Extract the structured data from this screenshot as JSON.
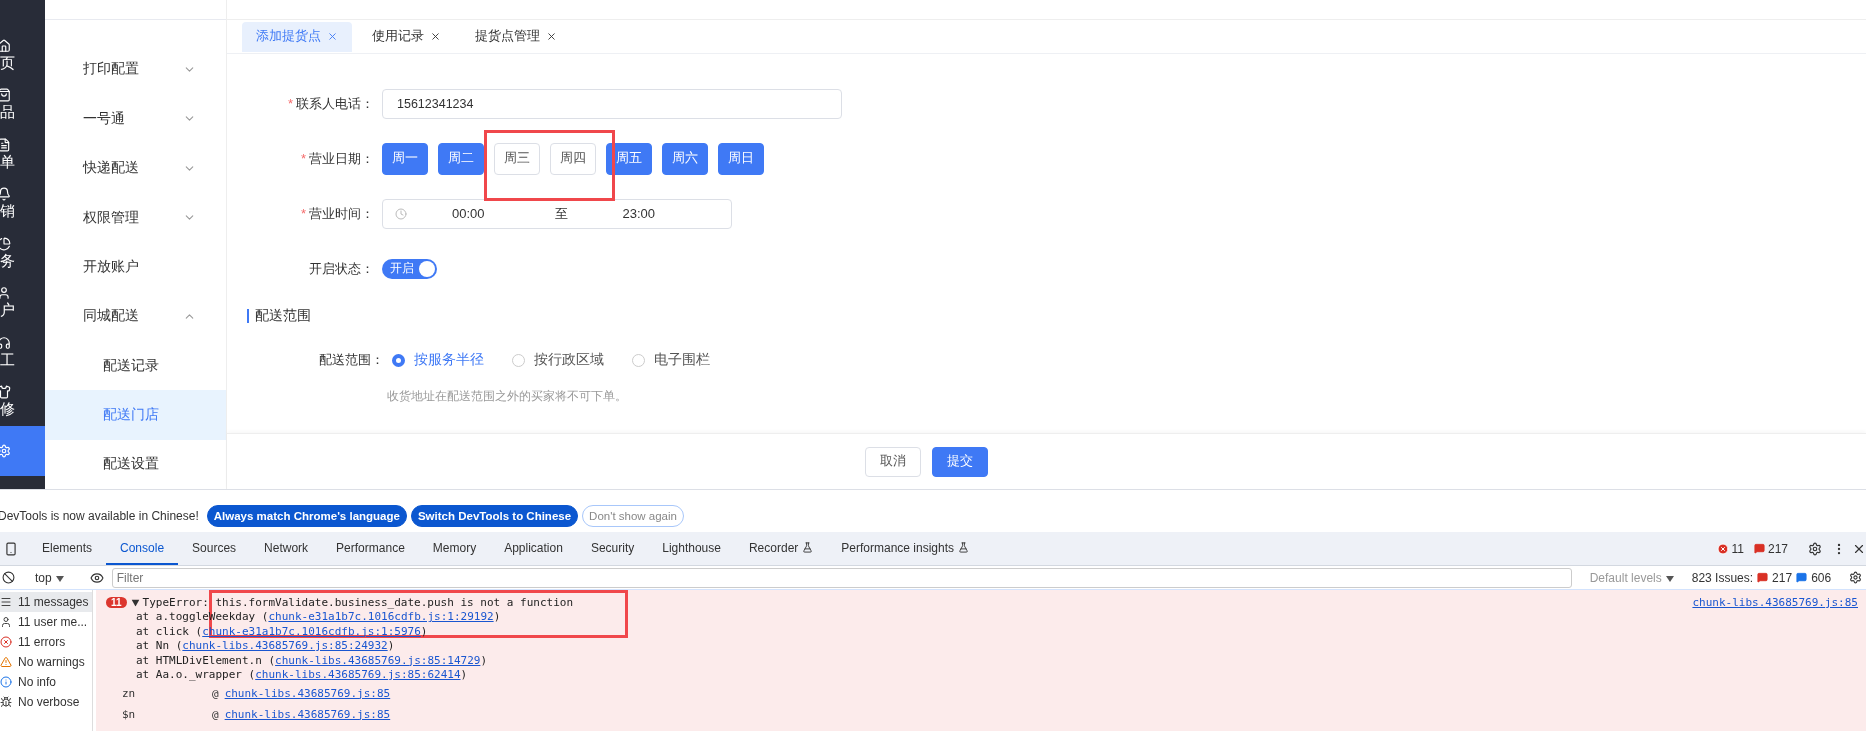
{
  "rail": [
    {
      "label": "页",
      "selected": false
    },
    {
      "label": "品",
      "selected": false
    },
    {
      "label": "单",
      "selected": false
    },
    {
      "label": "销",
      "selected": false
    },
    {
      "label": "务",
      "selected": false
    },
    {
      "label": "户",
      "selected": false
    },
    {
      "label": "工",
      "selected": false
    },
    {
      "label": "修",
      "selected": false
    },
    {
      "selected": true
    }
  ],
  "menu": [
    {
      "label": "打印配置",
      "kind": "group",
      "expanded": false
    },
    {
      "label": "一号通",
      "kind": "group",
      "expanded": false
    },
    {
      "label": "快递配送",
      "kind": "group",
      "expanded": false
    },
    {
      "label": "权限管理",
      "kind": "group",
      "expanded": false
    },
    {
      "label": "开放账户",
      "kind": "link"
    },
    {
      "label": "同城配送",
      "kind": "group",
      "expanded": true,
      "children": [
        {
          "label": "配送记录",
          "selected": false
        },
        {
          "label": "配送门店",
          "selected": true
        },
        {
          "label": "配送设置",
          "selected": false
        }
      ]
    }
  ],
  "tabs": [
    {
      "label": "添加提货点",
      "selected": true
    },
    {
      "label": "使用记录",
      "selected": false
    },
    {
      "label": "提货点管理",
      "selected": false
    }
  ],
  "form": {
    "required_mark": "*",
    "phone": {
      "label": "联系人电话：",
      "required": true,
      "value": "15612341234"
    },
    "days": {
      "label": "营业日期：",
      "required": true,
      "options": [
        {
          "label": "周一",
          "selected": true
        },
        {
          "label": "周二",
          "selected": true
        },
        {
          "label": "周三",
          "selected": false
        },
        {
          "label": "周四",
          "selected": false
        },
        {
          "label": "周五",
          "selected": true
        },
        {
          "label": "周六",
          "selected": true
        },
        {
          "label": "周日",
          "selected": true
        }
      ]
    },
    "hours": {
      "label": "营业时间：",
      "required": true,
      "start": "00:00",
      "separator": "至",
      "end": "23:00"
    },
    "status": {
      "label": "开启状态：",
      "on": true,
      "text": "开启"
    },
    "section": "配送范围",
    "scope": {
      "label": "配送范围：",
      "options": [
        {
          "label": "按服务半径",
          "selected": true
        },
        {
          "label": "按行政区域",
          "selected": false
        },
        {
          "label": "电子围栏",
          "selected": false
        }
      ],
      "hint": "收货地址在配送范围之外的买家将不可下单。"
    }
  },
  "footer": [
    {
      "label": "取消",
      "kind": "secondary"
    },
    {
      "label": "提交",
      "kind": "primary"
    }
  ],
  "devtools": {
    "banner": {
      "text": "DevTools is now available in Chinese!",
      "buttons": [
        {
          "label": "Always match Chrome's language",
          "kind": "filled"
        },
        {
          "label": "Switch DevTools to Chinese",
          "kind": "filled"
        },
        {
          "label": "Don't show again",
          "kind": "outline"
        }
      ]
    },
    "tabs": [
      {
        "label": "Elements",
        "selected": false
      },
      {
        "label": "Console",
        "selected": true
      },
      {
        "label": "Sources",
        "selected": false
      },
      {
        "label": "Network",
        "selected": false
      },
      {
        "label": "Performance",
        "selected": false
      },
      {
        "label": "Memory",
        "selected": false
      },
      {
        "label": "Application",
        "selected": false
      },
      {
        "label": "Security",
        "selected": false
      },
      {
        "label": "Lighthouse",
        "selected": false
      },
      {
        "label": "Recorder",
        "selected": false,
        "experimental": true
      },
      {
        "label": "Performance insights",
        "selected": false,
        "experimental": true
      }
    ],
    "error_count": "11",
    "issue_count": "217",
    "toolbar": {
      "context": "top",
      "filter_placeholder": "Filter",
      "levels": "Default levels",
      "issues_label": "823 Issues:",
      "issues_errors": "217",
      "issues_info": "606"
    },
    "sidebar": [
      {
        "label": "11 messages",
        "selected": true
      },
      {
        "label": "11 user me...",
        "selected": false
      },
      {
        "label": "11 errors",
        "selected": false
      },
      {
        "label": "No warnings",
        "selected": false
      },
      {
        "label": "No info",
        "selected": false
      },
      {
        "label": "No verbose",
        "selected": false
      }
    ],
    "error": {
      "badge": "11",
      "expanded": true,
      "message": "TypeError: this.formValidate.business_date.push is not a function",
      "source": "chunk-libs.43685769.js:85",
      "stack": [
        {
          "prefix": "at a.toggleWeekday (",
          "link": "chunk-e31a1b7c.1016cdfb.js:1:29192",
          "suffix": ")"
        },
        {
          "prefix": "at click (",
          "link": "chunk-e31a1b7c.1016cdfb.js:1:5976",
          "suffix": ")"
        },
        {
          "prefix": "at Nn (",
          "link": "chunk-libs.43685769.js:85:24932",
          "suffix": ")"
        },
        {
          "prefix": "at HTMLDivElement.n (",
          "link": "chunk-libs.43685769.js:85:14729",
          "suffix": ")"
        },
        {
          "prefix": "at Aa.o._wrapper (",
          "link": "chunk-libs.43685769.js:85:62414",
          "suffix": ")"
        }
      ],
      "frames": [
        {
          "name": "zn",
          "at": "@",
          "link": "chunk-libs.43685769.js:85"
        },
        {
          "name": "$n",
          "at": "@",
          "link": "chunk-libs.43685769.js:85"
        }
      ]
    }
  }
}
